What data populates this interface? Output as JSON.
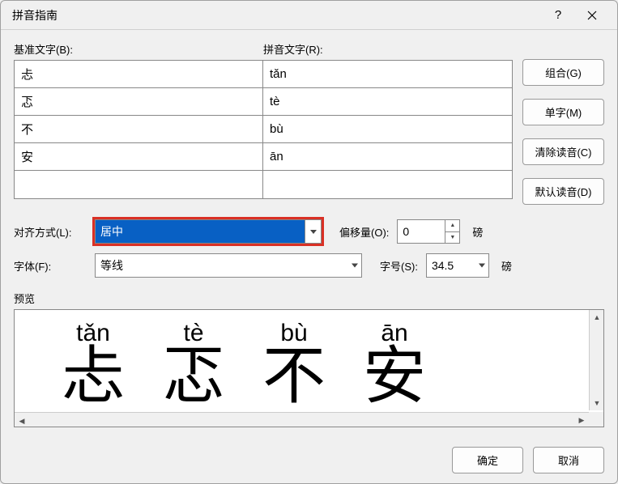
{
  "title": "拼音指南",
  "headers": {
    "base": "基准文字(B):",
    "ruby": "拼音文字(R):"
  },
  "rows": [
    {
      "base": "忐",
      "ruby": "tǎn"
    },
    {
      "base": "忑",
      "ruby": "tè"
    },
    {
      "base": "不",
      "ruby": "bù"
    },
    {
      "base": "安",
      "ruby": "ān"
    },
    {
      "base": "",
      "ruby": ""
    }
  ],
  "sideButtons": {
    "combine": "组合(G)",
    "single": "单字(M)",
    "clear": "清除读音(C)",
    "default": "默认读音(D)"
  },
  "labels": {
    "alignment": "对齐方式(L):",
    "offset": "偏移量(O):",
    "font": "字体(F):",
    "size": "字号(S):",
    "preview": "预览",
    "unit_pt": "磅"
  },
  "values": {
    "alignment": "居中",
    "offset": "0",
    "font": "等线",
    "size": "34.5"
  },
  "preview": [
    {
      "ruby": "tǎn",
      "base": "忐"
    },
    {
      "ruby": "tè",
      "base": "忑"
    },
    {
      "ruby": "bù",
      "base": "不"
    },
    {
      "ruby": "ān",
      "base": "安"
    }
  ],
  "buttons": {
    "ok": "确定",
    "cancel": "取消"
  }
}
